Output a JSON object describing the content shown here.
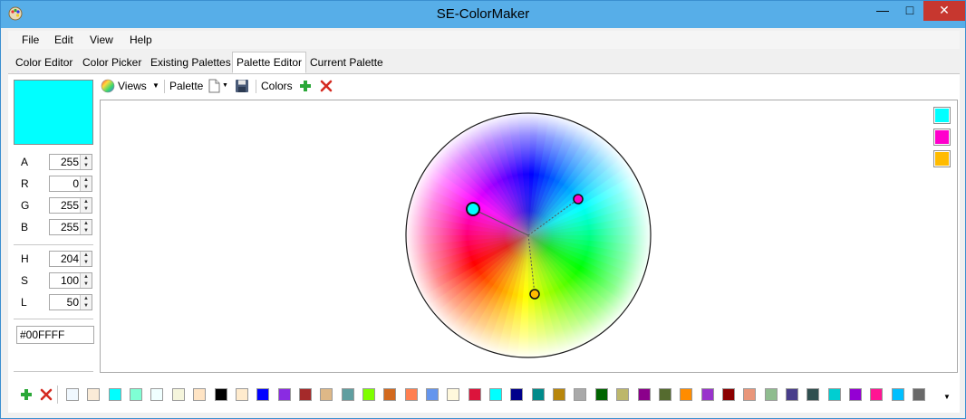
{
  "window": {
    "title": "SE-ColorMaker"
  },
  "menu": {
    "items": [
      "File",
      "Edit",
      "View",
      "Help"
    ]
  },
  "tabs": [
    "Color Editor",
    "Color Picker",
    "Existing Palettes",
    "Palette Editor",
    "Current Palette"
  ],
  "active_tab": "Palette Editor",
  "current_color": "#00FFFF",
  "fields": {
    "A": "255",
    "R": "0",
    "G": "255",
    "B": "255",
    "H": "204",
    "S": "100",
    "L": "50"
  },
  "hex_value": "#00FFFF",
  "toolbar": {
    "views_label": "Views",
    "palette_label": "Palette",
    "colors_label": "Colors"
  },
  "selected_colors": [
    "#00ffff",
    "#ff00cc",
    "#ffbb00"
  ],
  "palette_colors": [
    "#f0f8ff",
    "#faebd7",
    "#00ffff",
    "#7fffd4",
    "#f0ffff",
    "#f5f5dc",
    "#ffe4c4",
    "#000000",
    "#ffebcd",
    "#0000ff",
    "#8a2be2",
    "#a52a2a",
    "#deb887",
    "#5f9ea0",
    "#7fff00",
    "#d2691e",
    "#ff7f50",
    "#6495ed",
    "#fff8dc",
    "#dc143c",
    "#00ffff",
    "#00008b",
    "#008b8b",
    "#b8860b",
    "#a9a9a9",
    "#006400",
    "#bdb76b",
    "#8b008b",
    "#556b2f",
    "#ff8c00",
    "#9932cc",
    "#8b0000",
    "#e9967a",
    "#8fbc8f",
    "#483d8b",
    "#2f4f4f",
    "#00ced1",
    "#9400d3",
    "#ff1493",
    "#00bfff",
    "#696969"
  ]
}
